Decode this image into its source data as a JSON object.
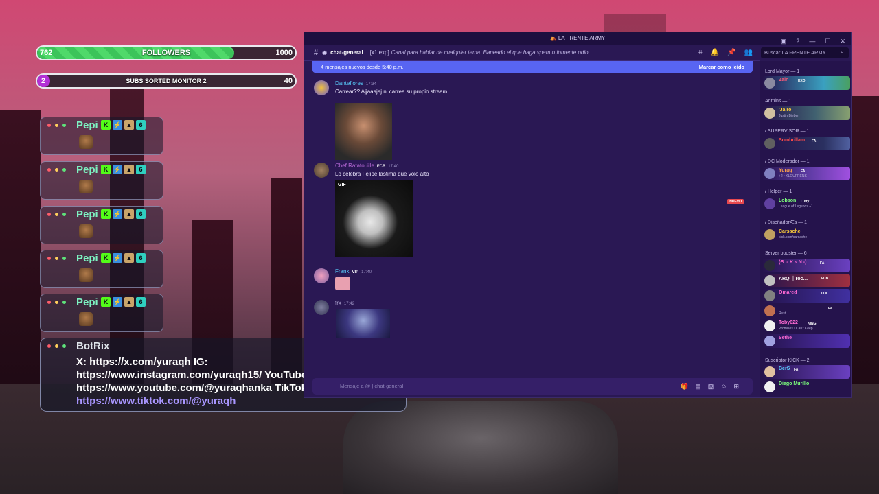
{
  "overlay": {
    "followers_bar": {
      "label": "FOLLOWERS",
      "current": "762",
      "goal": "1000",
      "progress": 0.762
    },
    "subs_bar": {
      "label": "SUBS SORTED MONITOR 2",
      "current": "2",
      "goal": "40",
      "progress": 0.05
    },
    "chat_cards": [
      {
        "name": "Pepi"
      },
      {
        "name": "Pepi"
      },
      {
        "name": "Pepi"
      },
      {
        "name": "Pepi"
      },
      {
        "name": "Pepi"
      }
    ],
    "botrix": {
      "name": "BotRix",
      "line1": "X: https://x.com/yuraqh IG:",
      "line2": "https://www.instagram.com/yuraqh15/ YouTube:",
      "line3": "https://www.youtube.com/@yuraqhanka TikTok:",
      "link": "https://www.tiktok.com/@yuraqh"
    }
  },
  "discord": {
    "window_title": "LA FRENTE ARMY",
    "channel": "chat-general",
    "topic_prefix": "[x1 exp]",
    "topic": "Canal para hablar de cualquier tema. Baneado el que haga spam o fomente odio.",
    "search_placeholder": "Buscar LA FRENTE ARMY",
    "new_messages": "4 mensajes nuevos desde 5:40 p.m.",
    "mark_read": "Marcar como leído",
    "new_tag": "NUEVO",
    "input_placeholder": "Mensaje a @ | chat-general",
    "messages": [
      {
        "author": "Danteflores",
        "time": "17:34",
        "text": "Carrear?? Ajjaaajaj ni carrea su propio stream",
        "color": "#5ad0ff"
      },
      {
        "author": "Chef Ratatouille",
        "time": "17:40",
        "text": "Lo celebra Felipe lastima que volo alto",
        "tag": "FCB",
        "color": "#b86ad8"
      },
      {
        "author": "Frank",
        "time": "17:40",
        "text": "",
        "tag": "VIP",
        "color": "#5ad0ff"
      },
      {
        "author": "frx",
        "time": "17:42",
        "text": "",
        "color": "#b9b0dc"
      }
    ],
    "gif_label": "GIF",
    "members": {
      "categories": [
        {
          "label": "Lord Mayor — 1"
        },
        {
          "label": "Admins — 1"
        },
        {
          "label": "/ SUPERVISOR — 1"
        },
        {
          "label": "/ DC Moderador — 1"
        },
        {
          "label": "/ Helper — 1"
        },
        {
          "label": "/ DiseñadorÆs — 1"
        },
        {
          "label": "Server booster — 6"
        },
        {
          "label": "Suscriptor KICK — 2"
        }
      ],
      "list": [
        {
          "name": "Zain",
          "tag": "EXO",
          "sub": "",
          "color": "#ff5a7a"
        },
        {
          "name": "'Jairo",
          "tag": "",
          "sub": "Justin Bieber",
          "color": "#ffcf3a"
        },
        {
          "name": "Sombrillam",
          "tag": "FA",
          "sub": "",
          "color": "#ff4a4a"
        },
        {
          "name": "Yuraq",
          "tag": "FA",
          "sub": "+2 • KLOUFRENS",
          "color": "#ffa24a"
        },
        {
          "name": "Lobson",
          "tag": "Luffy",
          "sub": "League of Legends +1",
          "color": "#7cff7c"
        },
        {
          "name": "Carsache",
          "tag": "",
          "sub": "kick.com/carsache",
          "color": "#ffcf3a"
        },
        {
          "name": "(Θ u K s N -)",
          "tag": "FA",
          "sub": "",
          "color": "#ff6ad5"
        },
        {
          "name": "ARQ ｜roc…",
          "tag": "FCB",
          "sub": "",
          "color": "#ffffff"
        },
        {
          "name": "Omared",
          "tag": "LOL",
          "sub": "",
          "color": "#ff6ad5"
        },
        {
          "name": "",
          "tag": "FA",
          "sub": "Rust",
          "color": "#ff6ad5"
        },
        {
          "name": "Toby022",
          "tag": "KING",
          "sub": "Promises I Can't Keep",
          "color": "#ff6ad5"
        },
        {
          "name": "Sethe",
          "tag": "",
          "sub": "",
          "color": "#ff6ad5"
        },
        {
          "name": "BerS",
          "tag": "FA",
          "sub": "",
          "color": "#5ad0ff"
        },
        {
          "name": "Diego Murillo",
          "tag": "",
          "sub": "",
          "color": "#7cff7c"
        }
      ]
    }
  }
}
